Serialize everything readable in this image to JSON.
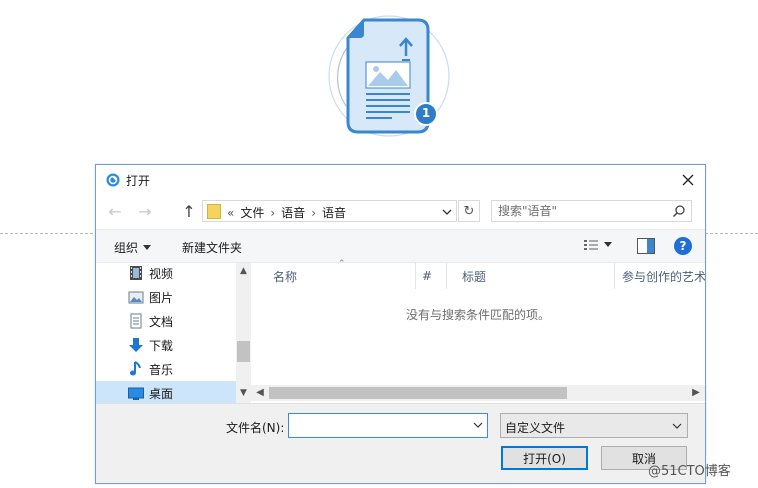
{
  "dialog": {
    "title": "打开",
    "address": {
      "crumb_prefix": "«",
      "crumbs": [
        "文件",
        "语音",
        "语音"
      ]
    },
    "search": {
      "placeholder": "搜索\"语音\""
    },
    "toolbar": {
      "organize_label": "组织",
      "new_folder_label": "新建文件夹",
      "help_label": "?"
    },
    "nav_items": [
      {
        "label": "视频",
        "icon": "video-icon"
      },
      {
        "label": "图片",
        "icon": "picture-icon"
      },
      {
        "label": "文档",
        "icon": "document-icon"
      },
      {
        "label": "下载",
        "icon": "download-icon"
      },
      {
        "label": "音乐",
        "icon": "music-icon"
      },
      {
        "label": "桌面",
        "icon": "desktop-icon",
        "selected": true
      }
    ],
    "columns": [
      "名称",
      "#",
      "标题",
      "参与创作的艺术"
    ],
    "empty_message": "没有与搜索条件匹配的项。",
    "filename_label": "文件名(N):",
    "filename_value": "",
    "filter_value": "自定义文件",
    "open_button": "打开(O)",
    "cancel_button": "取消"
  },
  "hero": {
    "badge_number": "1"
  },
  "watermark": "@51CTO博客",
  "colors": {
    "accent": "#0078d7",
    "hero_blue": "#3a86d0",
    "hero_light": "#d7e8f8",
    "selected_bg": "#cce5fb"
  }
}
